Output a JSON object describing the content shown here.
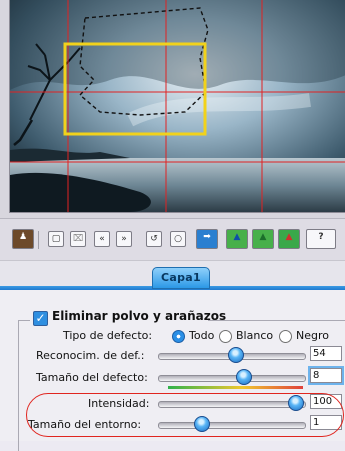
{
  "layer_tab": {
    "label": "Capa1"
  },
  "dust_filter": {
    "checkbox_label": "Eliminar polvo y arañazos",
    "checked": true
  },
  "defect_type": {
    "label": "Tipo de defecto:",
    "options": [
      "Todo",
      "Blanco",
      "Negro"
    ],
    "selected": "Todo"
  },
  "sliders": [
    {
      "label": "Reconocim. de def.:",
      "value": "54",
      "level": 0.54
    },
    {
      "label": "Tamaño del defecto:",
      "value": "8",
      "level": 0.6
    },
    {
      "label": "Intensidad:",
      "value": "100",
      "level": 1.0
    },
    {
      "label": "Tamaño del entorno:",
      "value": "1",
      "level": 0.28
    }
  ],
  "colors": {
    "accent": "#2a8fe6",
    "selection_rect": "#f2d21b",
    "grid_lines": "#e02222",
    "highlight": "#e0251f"
  },
  "toolbar_icons": [
    "preset-portrait-icon",
    "new-document-icon",
    "trash-icon",
    "rewind-icon",
    "fast-forward-icon",
    "undo-icon",
    "lasso-icon",
    "arrow-right-icon",
    "mountain-green-icon",
    "mountain-green-2-icon",
    "mountain-red-icon",
    "help-icon"
  ]
}
